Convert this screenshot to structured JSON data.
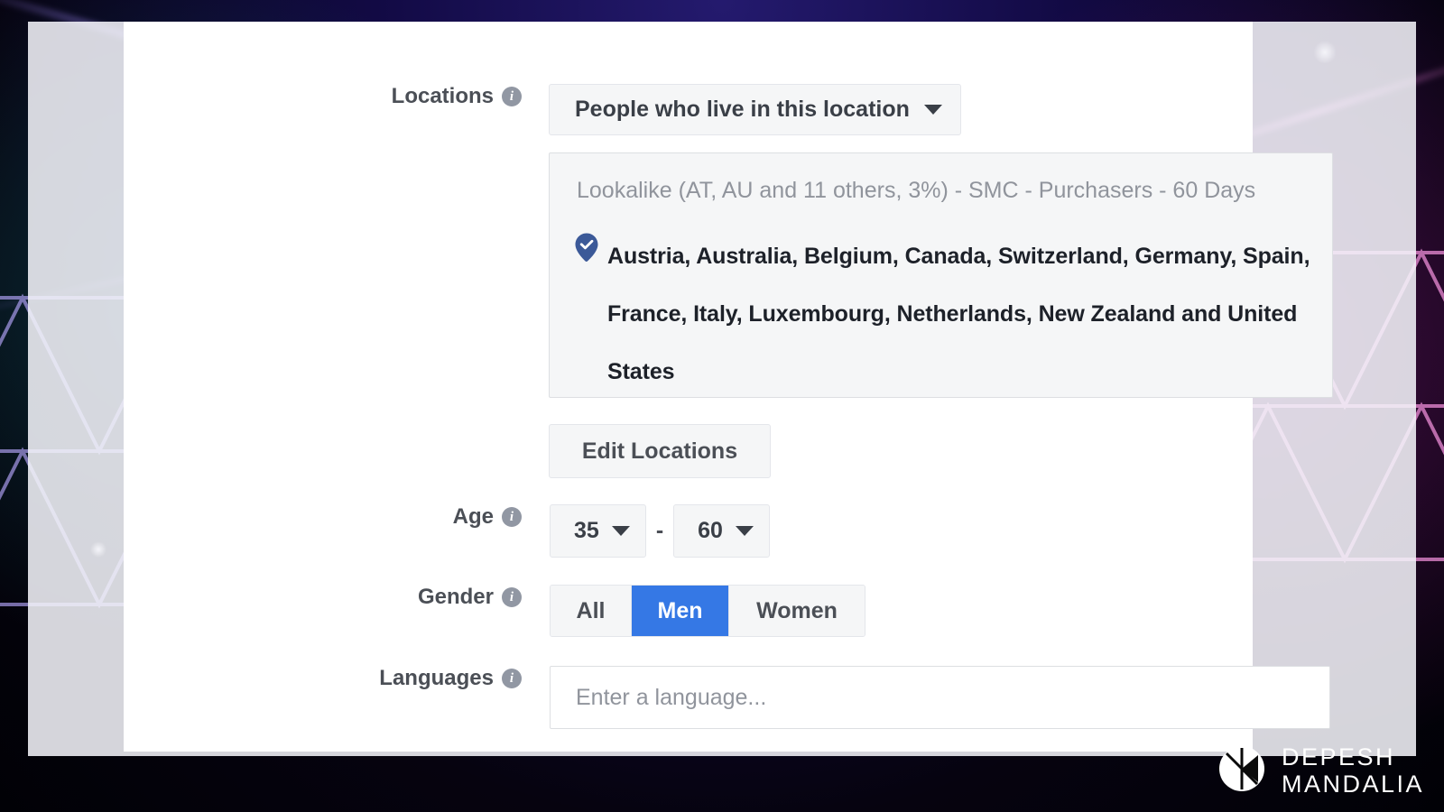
{
  "theme": {
    "accent_blue": "#3578E5",
    "pin_blue": "#3B5998",
    "label_gray": "#4B4F56",
    "placeholder_gray": "#90949C",
    "field_bg": "#F5F6F7",
    "field_border": "#E4E6EB",
    "text_dark": "#1D2129"
  },
  "form": {
    "locations": {
      "label": "Locations",
      "info_icon": "info-icon",
      "type_dropdown": {
        "value": "People who live in this location",
        "caret_icon": "chevron-down-icon"
      },
      "search_placeholder": "Lookalike (AT, AU and 11 others, 3%) - SMC - Purchasers - 60 Days",
      "selected": {
        "pin_icon": "map-pin-check-icon",
        "text": "Austria, Australia, Belgium, Canada, Switzerland, Germany, Spain, France, Italy, Luxembourg, Netherlands, New Zealand and United States",
        "countries": [
          "Austria",
          "Australia",
          "Belgium",
          "Canada",
          "Switzerland",
          "Germany",
          "Spain",
          "France",
          "Italy",
          "Luxembourg",
          "Netherlands",
          "New Zealand",
          "United States"
        ]
      },
      "edit_button_label": "Edit Locations"
    },
    "age": {
      "label": "Age",
      "info_icon": "info-icon",
      "min_value": "35",
      "max_value": "60",
      "separator": "-",
      "caret_icon": "chevron-down-icon"
    },
    "gender": {
      "label": "Gender",
      "info_icon": "info-icon",
      "options": [
        {
          "label": "All",
          "selected": false
        },
        {
          "label": "Men",
          "selected": true
        },
        {
          "label": "Women",
          "selected": false
        }
      ]
    },
    "languages": {
      "label": "Languages",
      "info_icon": "info-icon",
      "value": "",
      "placeholder": "Enter a language..."
    }
  },
  "watermark": {
    "logo_icon": "depesh-mandalia-logo-icon",
    "line1": "DEPESH",
    "line2": "MANDALIA"
  },
  "icons": {
    "info_glyph": "i"
  }
}
